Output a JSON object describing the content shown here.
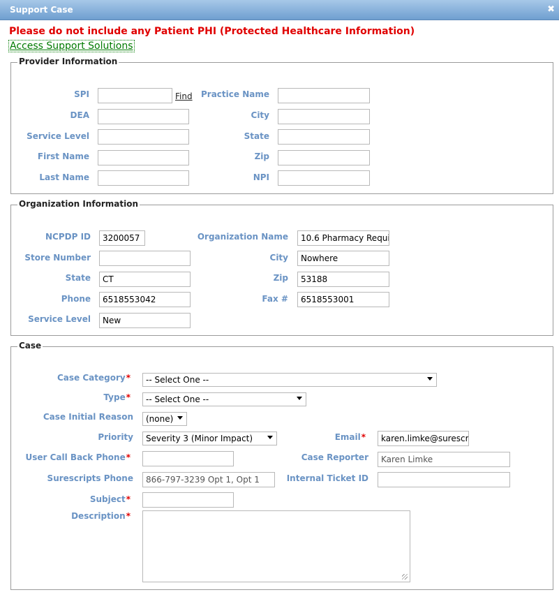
{
  "dialog": {
    "title": "Support Case",
    "close_glyph": "✖"
  },
  "warning": "Please do not include any Patient PHI (Protected Healthcare Information)",
  "support_link": "Access Support Solutions",
  "provider": {
    "legend": "Provider Information",
    "spi_label": "SPI",
    "spi_value": "",
    "find_label": "Find",
    "dea_label": "DEA",
    "dea_value": "",
    "service_level_label": "Service Level",
    "service_level_value": "",
    "first_name_label": "First Name",
    "first_name_value": "",
    "last_name_label": "Last Name",
    "last_name_value": "",
    "practice_name_label": "Practice Name",
    "practice_name_value": "",
    "city_label": "City",
    "city_value": "",
    "state_label": "State",
    "state_value": "",
    "zip_label": "Zip",
    "zip_value": "",
    "npi_label": "NPI",
    "npi_value": ""
  },
  "organization": {
    "legend": "Organization Information",
    "ncpdp_label": "NCPDP ID",
    "ncpdp_value": "3200057",
    "store_number_label": "Store Number",
    "store_number_value": "",
    "state_label": "State",
    "state_value": "CT",
    "phone_label": "Phone",
    "phone_value": "6518553042",
    "service_level_label": "Service Level",
    "service_level_value": "New",
    "org_name_label": "Organization Name",
    "org_name_value": "10.6 Pharmacy Requi",
    "city_label": "City",
    "city_value": "Nowhere",
    "zip_label": "Zip",
    "zip_value": "53188",
    "fax_label": "Fax #",
    "fax_value": "6518553001"
  },
  "case": {
    "legend": "Case",
    "required_mark": "*",
    "category_label": "Case Category",
    "category_value": "-- Select One --",
    "type_label": "Type",
    "type_value": "-- Select One --",
    "initial_reason_label": "Case Initial Reason",
    "initial_reason_value": "(none)",
    "priority_label": "Priority",
    "priority_value": "Severity 3 (Minor Impact)",
    "callback_label": "User Call Back Phone",
    "callback_value": "",
    "surescripts_phone_label": "Surescripts Phone",
    "surescripts_phone_value": "866-797-3239 Opt 1, Opt 1",
    "subject_label": "Subject",
    "subject_value": "",
    "description_label": "Description",
    "description_value": "",
    "email_label": "Email",
    "email_value": "karen.limke@surescri",
    "reporter_label": "Case Reporter",
    "reporter_value": "Karen Limke",
    "ticket_label": "Internal Ticket ID",
    "ticket_value": ""
  }
}
